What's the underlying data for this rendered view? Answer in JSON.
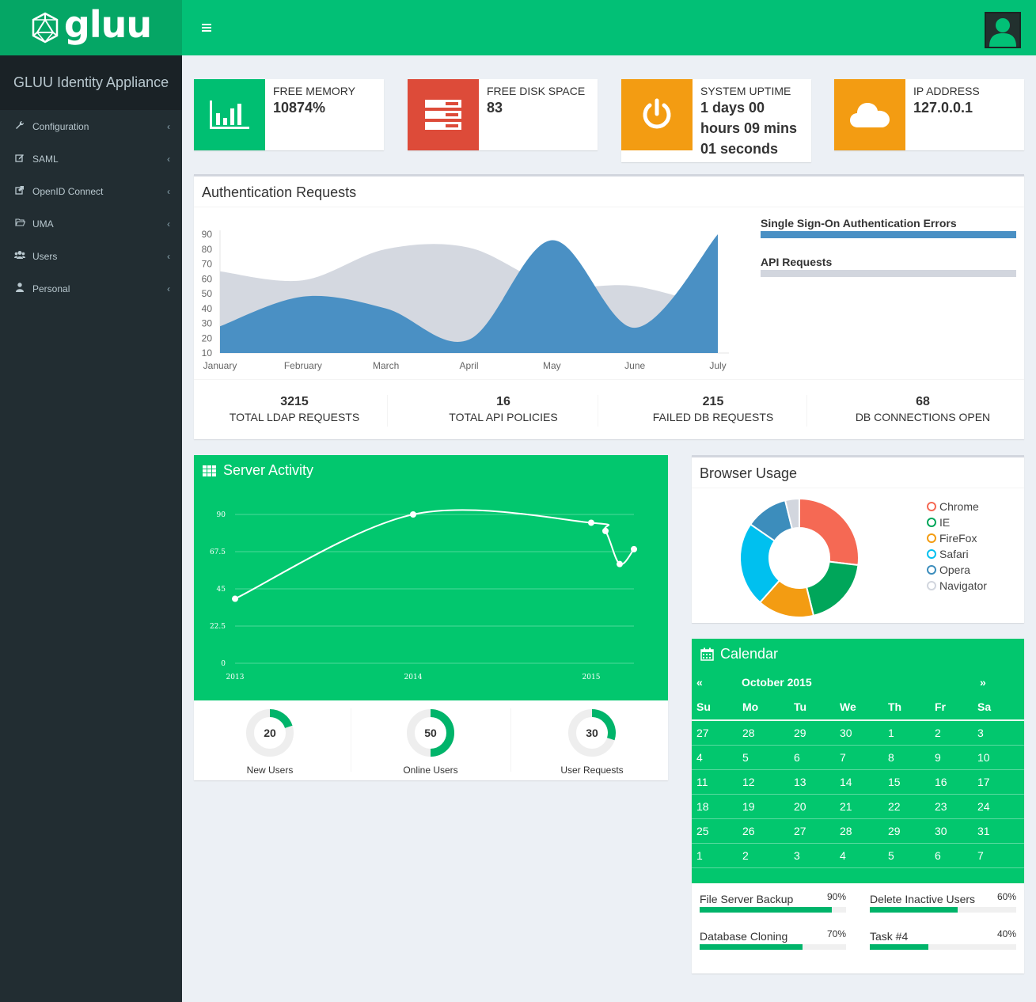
{
  "header": {
    "logo_text": "gluu",
    "menu_icon": "hamburger-icon",
    "avatar_icon": "user-avatar-icon"
  },
  "sidebar": {
    "brand": "GLUU Identity Appliance",
    "items": [
      {
        "label": "Configuration",
        "icon": "wrench-icon"
      },
      {
        "label": "SAML",
        "icon": "edit-icon"
      },
      {
        "label": "OpenID Connect",
        "icon": "external-link-icon"
      },
      {
        "label": "UMA",
        "icon": "folder-open-icon"
      },
      {
        "label": "Users",
        "icon": "users-icon"
      },
      {
        "label": "Personal",
        "icon": "user-icon"
      }
    ]
  },
  "info_boxes": [
    {
      "label": "FREE MEMORY",
      "value": "10874%",
      "color": "#00bf72",
      "icon": "bar-chart-icon"
    },
    {
      "label": "FREE DISK SPACE",
      "value": "83",
      "color": "#dd4b39",
      "icon": "server-icon"
    },
    {
      "label": "SYSTEM UPTIME",
      "value_lines": [
        "1 days 00",
        "hours 09 mins",
        "01 seconds"
      ],
      "color": "#f39c12",
      "icon": "power-icon"
    },
    {
      "label": "IP ADDRESS",
      "value": "127.0.0.1",
      "color": "#f39c12",
      "icon": "cloud-icon"
    }
  ],
  "auth_requests": {
    "title": "Authentication Requests",
    "legend": [
      {
        "label": "Single Sign-On Authentication Errors",
        "color": "#4a90c4"
      },
      {
        "label": "API Requests",
        "color": "#d2d6de"
      }
    ],
    "stats": [
      {
        "value": "3215",
        "label": "TOTAL LDAP REQUESTS"
      },
      {
        "value": "16",
        "label": "TOTAL API POLICIES"
      },
      {
        "value": "215",
        "label": "FAILED DB REQUESTS"
      },
      {
        "value": "68",
        "label": "DB CONNECTIONS OPEN"
      }
    ]
  },
  "server_activity": {
    "title": "Server Activity",
    "icon": "grid-icon",
    "knobs": [
      {
        "value": "20",
        "label": "New Users",
        "fraction": 0.2
      },
      {
        "value": "50",
        "label": "Online Users",
        "fraction": 0.5
      },
      {
        "value": "30",
        "label": "User Requests",
        "fraction": 0.3
      }
    ]
  },
  "browser_usage": {
    "title": "Browser Usage",
    "legend": [
      {
        "label": "Chrome",
        "color": "#f56954"
      },
      {
        "label": "IE",
        "color": "#00a65a"
      },
      {
        "label": "FireFox",
        "color": "#f39c12"
      },
      {
        "label": "Safari",
        "color": "#00c0ef"
      },
      {
        "label": "Opera",
        "color": "#3c8dbc"
      },
      {
        "label": "Navigator",
        "color": "#d2d6de"
      }
    ]
  },
  "calendar": {
    "title": "Calendar",
    "icon": "calendar-icon",
    "prev": "«",
    "next": "»",
    "month": "October 2015",
    "weekdays": [
      "Su",
      "Mo",
      "Tu",
      "We",
      "Th",
      "Fr",
      "Sa"
    ],
    "weeks": [
      [
        "27",
        "28",
        "29",
        "30",
        "1",
        "2",
        "3"
      ],
      [
        "4",
        "5",
        "6",
        "7",
        "8",
        "9",
        "10"
      ],
      [
        "11",
        "12",
        "13",
        "14",
        "15",
        "16",
        "17"
      ],
      [
        "18",
        "19",
        "20",
        "21",
        "22",
        "23",
        "24"
      ],
      [
        "25",
        "26",
        "27",
        "28",
        "29",
        "30",
        "31"
      ],
      [
        "1",
        "2",
        "3",
        "4",
        "5",
        "6",
        "7"
      ]
    ]
  },
  "tasks": [
    {
      "name": "File Server Backup",
      "pct": "90%",
      "fraction": 0.9
    },
    {
      "name": "Delete Inactive Users",
      "pct": "60%",
      "fraction": 0.6
    },
    {
      "name": "Database Cloning",
      "pct": "70%",
      "fraction": 0.7
    },
    {
      "name": "Task #4",
      "pct": "40%",
      "fraction": 0.4
    }
  ],
  "chart_data": [
    {
      "type": "area",
      "categories": [
        "January",
        "February",
        "March",
        "April",
        "May",
        "June",
        "July"
      ],
      "series": [
        {
          "name": "API Requests",
          "values": [
            65,
            59,
            80,
            81,
            56,
            55,
            40
          ]
        },
        {
          "name": "Single Sign-On Authentication Errors",
          "values": [
            28,
            48,
            40,
            19,
            86,
            27,
            90
          ]
        }
      ],
      "ylim": [
        10,
        90
      ],
      "yticks": [
        "10",
        "20",
        "30",
        "40",
        "50",
        "60",
        "70",
        "80",
        "90"
      ]
    },
    {
      "type": "line",
      "x": [
        2013.0,
        2014.0,
        2015.0,
        2015.08,
        2015.16,
        2015.24
      ],
      "values": [
        39,
        90,
        85,
        80,
        60,
        69
      ],
      "xticks": [
        "2013",
        "2014",
        "2015"
      ],
      "yticks": [
        "0",
        "22.5",
        "45",
        "67.5",
        "90"
      ],
      "ylim": [
        0,
        90
      ]
    },
    {
      "type": "pie",
      "categories": [
        "Chrome",
        "IE",
        "FireFox",
        "Safari",
        "Opera",
        "Navigator"
      ],
      "values": [
        700,
        500,
        400,
        600,
        300,
        100
      ]
    }
  ]
}
